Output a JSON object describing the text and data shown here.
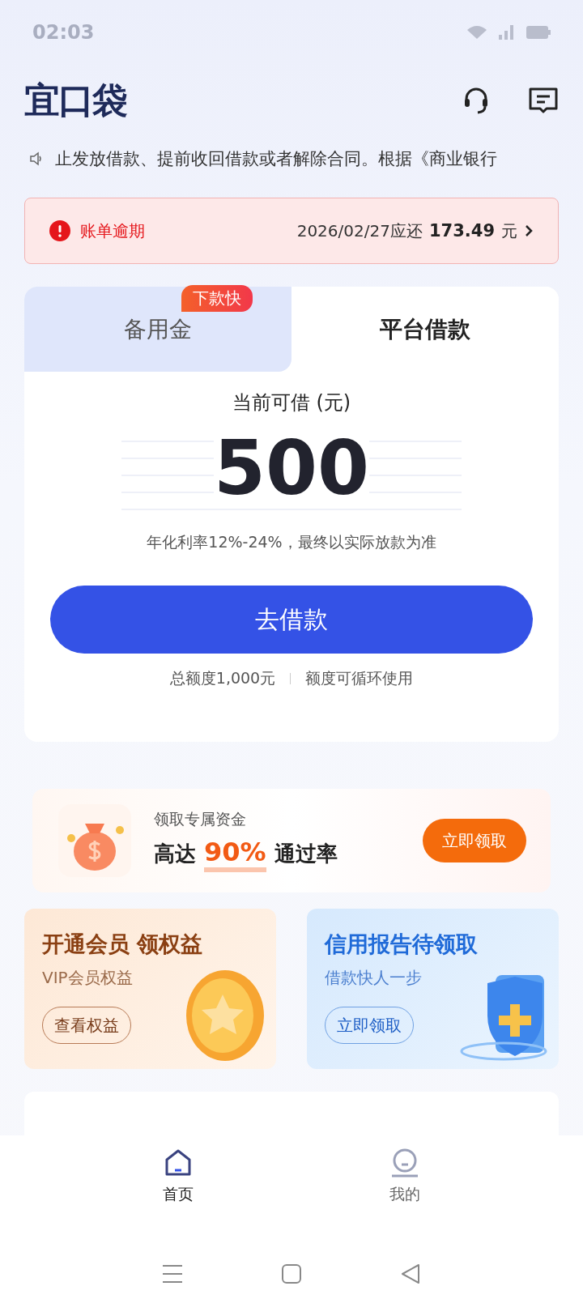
{
  "status_bar": {
    "time": "02:03"
  },
  "header": {
    "logo": "宜口袋"
  },
  "notice": {
    "text": "止发放借款、提前收回借款或者解除合同。根据《商业银行"
  },
  "alert": {
    "label": "账单逾期",
    "due": "2026/02/27应还",
    "amount": "173.49",
    "unit": "元"
  },
  "tabs": [
    {
      "label": "备用金",
      "selected": false,
      "badge": "下款快"
    },
    {
      "label": "平台借款",
      "selected": true
    }
  ],
  "loan": {
    "caption": "当前可借 (元)",
    "amount": "500",
    "rate_note": "年化利率12%-24%，最终以实际放款为准",
    "button": "去借款",
    "total": "总额度1,000元",
    "reuse": "额度可循环使用"
  },
  "promo": {
    "subtitle": "领取专属资金",
    "title_before": "高达",
    "highlight": "90%",
    "title_after": "通过率",
    "button": "立即领取"
  },
  "cards": [
    {
      "kind": "member",
      "title": "开通会员 领权益",
      "subtitle": "VIP会员权益",
      "button": "查看权益"
    },
    {
      "kind": "credit",
      "title": "信用报告待领取",
      "subtitle": "借款快人一步",
      "button": "立即领取"
    }
  ],
  "bottom_nav": [
    {
      "label": "首页",
      "selected": true
    },
    {
      "label": "我的",
      "selected": false
    }
  ]
}
